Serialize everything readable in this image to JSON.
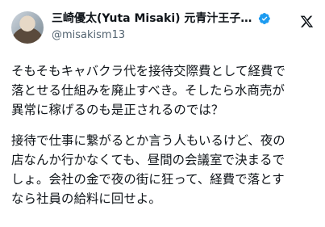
{
  "post": {
    "author": {
      "display_name": "三崎優太(Yuta Misaki) 元青汁王子 ...",
      "handle": "@misakism13",
      "verified": true
    },
    "brand_icon": "x-logo-icon",
    "paragraphs": [
      "そもそもキャバクラ代を接待交際費として経費で\n落とせる仕組みを廃止すべき。そしたら水商売が\n異常に稼げるのも是正されるのでは？",
      "接待で仕事に繋がるとか言う人もいるけど、夜の\n店なんか行かなくても、昼間の会議室で決まるで\nしょ。会社の金で夜の街に狂って、経費で落とす\nなら社員の給料に回せよ。"
    ]
  },
  "colors": {
    "verified_badge": "#1d9bf0",
    "text_primary": "#0f1419",
    "text_secondary": "#536471"
  }
}
